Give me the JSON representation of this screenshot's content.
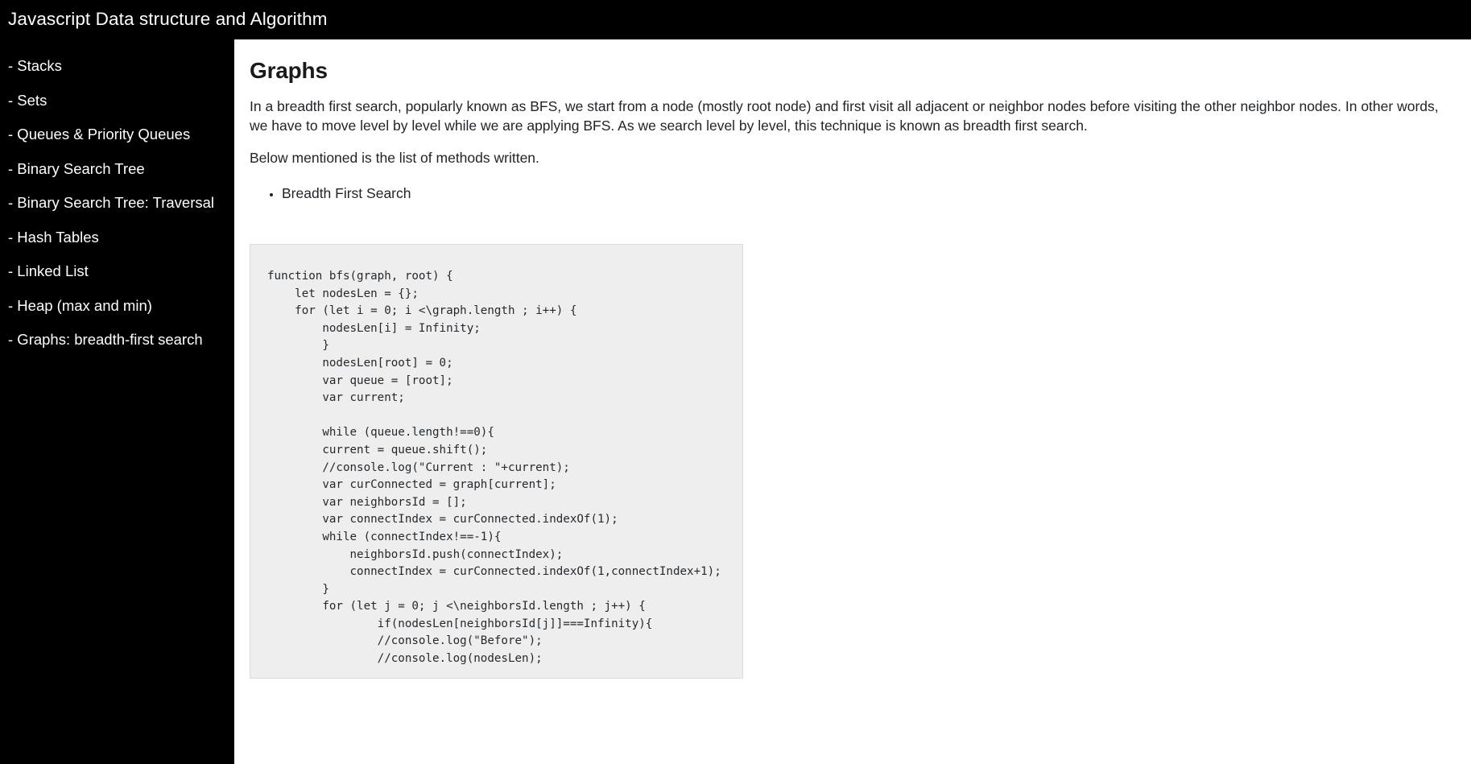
{
  "header": {
    "title": "Javascript Data structure and Algorithm"
  },
  "sidebar": {
    "items": [
      {
        "label": "- Stacks",
        "name": "sidebar-item-stacks"
      },
      {
        "label": "- Sets",
        "name": "sidebar-item-sets"
      },
      {
        "label": "- Queues & Priority Queues",
        "name": "sidebar-item-queues-priority-queues"
      },
      {
        "label": "- Binary Search Tree",
        "name": "sidebar-item-binary-search-tree"
      },
      {
        "label": "- Binary Search Tree: Traversal",
        "name": "sidebar-item-binary-search-tree-traversal"
      },
      {
        "label": "- Hash Tables",
        "name": "sidebar-item-hash-tables"
      },
      {
        "label": "- Linked List",
        "name": "sidebar-item-linked-list"
      },
      {
        "label": "- Heap (max and min)",
        "name": "sidebar-item-heap"
      },
      {
        "label": "- Graphs: breadth-first search",
        "name": "sidebar-item-graphs-breadth-first-search"
      }
    ]
  },
  "main": {
    "heading": "Graphs",
    "paragraph_1": "In a breadth first search, popularly known as BFS, we start from a node (mostly root node) and first visit all adjacent or neighbor nodes before visiting the other neighbor nodes. In other words, we have to move level by level while we are applying BFS. As we search level by level, this technique is known as breadth first search.",
    "paragraph_2": "Below mentioned is the list of methods written.",
    "methods": [
      "Breadth First Search"
    ],
    "code": "function bfs(graph, root) {\n    let nodesLen = {};\n    for (let i = 0; i <\\graph.length ; i++) {\n        nodesLen[i] = Infinity;\n        }\n        nodesLen[root] = 0;\n        var queue = [root];\n        var current;\n\n        while (queue.length!==0){\n        current = queue.shift();\n        //console.log(\"Current : \"+current);\n        var curConnected = graph[current];\n        var neighborsId = [];\n        var connectIndex = curConnected.indexOf(1);\n        while (connectIndex!==-1){\n            neighborsId.push(connectIndex);\n            connectIndex = curConnected.indexOf(1,connectIndex+1);\n        }\n        for (let j = 0; j <\\neighborsId.length ; j++) {\n                if(nodesLen[neighborsId[j]]===Infinity){\n                //console.log(\"Before\");\n                //console.log(nodesLen);"
  },
  "colors": {
    "header_bg": "#000000",
    "sidebar_bg": "#000000",
    "sidebar_text": "#ffffff",
    "content_bg": "#ffffff",
    "body_text": "#1f2328",
    "code_bg": "#eeeeee",
    "code_border": "#dcdcdc",
    "code_text": "#24292e"
  }
}
